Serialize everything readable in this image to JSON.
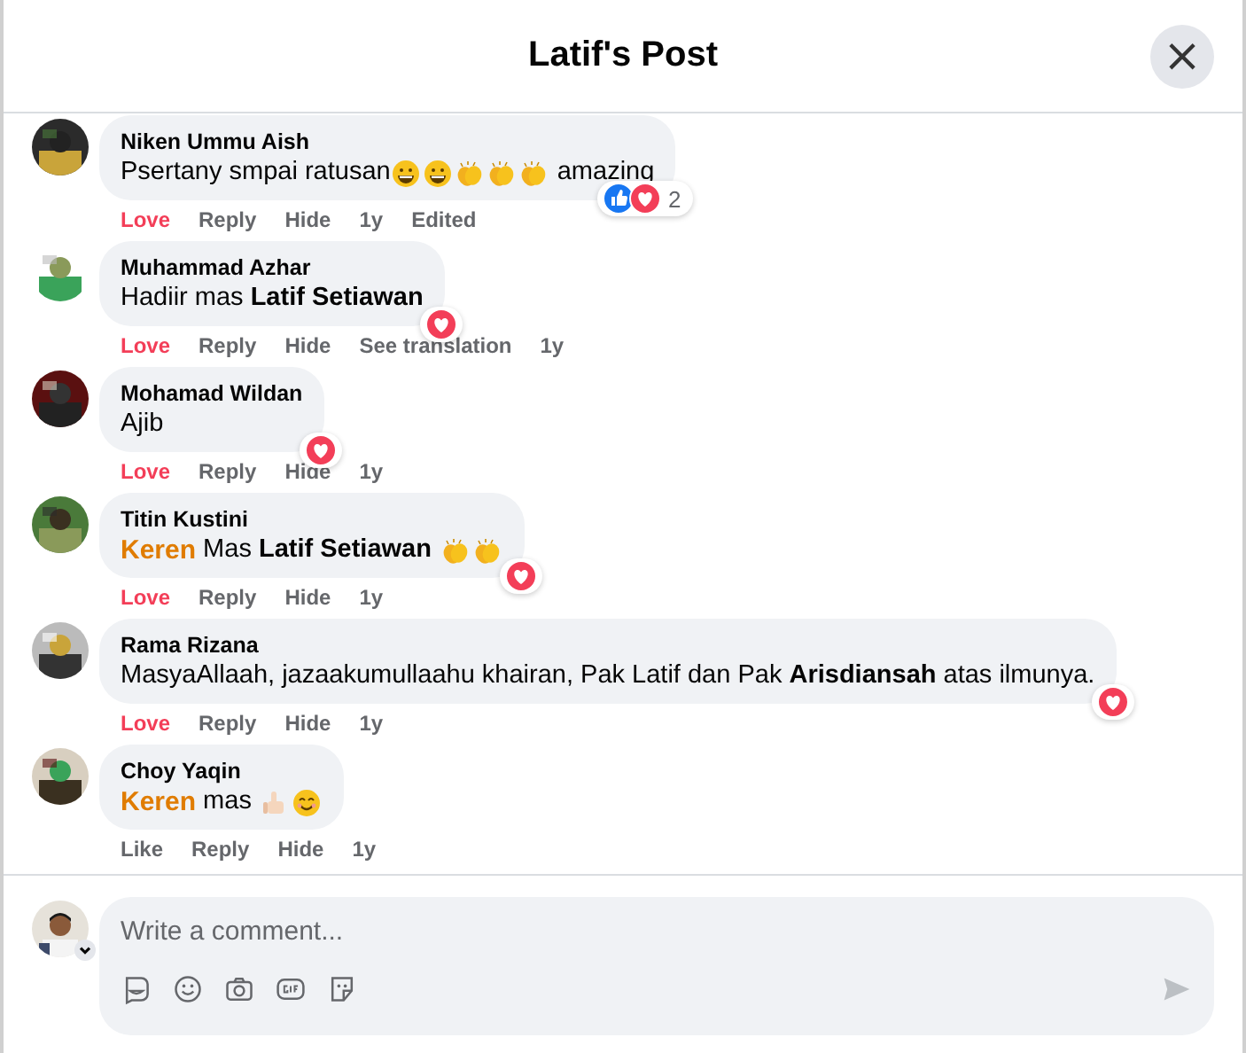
{
  "dialog": {
    "title": "Latif's Post",
    "close": "×"
  },
  "comments": [
    {
      "name": "Niken Ummu Aish",
      "segments": [
        {
          "kind": "text",
          "text": "Psertany smpai ratusan"
        },
        {
          "kind": "grin"
        },
        {
          "kind": "grin"
        },
        {
          "kind": "clap"
        },
        {
          "kind": "clap"
        },
        {
          "kind": "clap"
        },
        {
          "kind": "text",
          "text": " amazing"
        }
      ],
      "reactions": {
        "like": true,
        "love": true,
        "count": "2"
      },
      "reaction": {
        "label": "Love",
        "selected": true
      },
      "actions": [
        "Reply",
        "Hide",
        "1y",
        "Edited"
      ]
    },
    {
      "name": "Muhammad Azhar",
      "segments": [
        {
          "kind": "text",
          "text": "Hadiir mas "
        },
        {
          "kind": "bold",
          "text": "Latif Setiawan"
        }
      ],
      "reactions": {
        "love": true
      },
      "reaction": {
        "label": "Love",
        "selected": true
      },
      "actions": [
        "Reply",
        "Hide",
        "See translation",
        "1y"
      ]
    },
    {
      "name": "Mohamad Wildan",
      "segments": [
        {
          "kind": "text",
          "text": "Ajib"
        }
      ],
      "reactions": {
        "love": true
      },
      "reaction": {
        "label": "Love",
        "selected": true
      },
      "actions": [
        "Reply",
        "Hide",
        "1y"
      ]
    },
    {
      "name": "Titin Kustini",
      "segments": [
        {
          "kind": "highlight",
          "text": "Keren"
        },
        {
          "kind": "text",
          "text": " Mas "
        },
        {
          "kind": "bold",
          "text": "Latif Setiawan "
        },
        {
          "kind": "clap"
        },
        {
          "kind": "clap"
        }
      ],
      "reactions": {
        "love": true
      },
      "reaction": {
        "label": "Love",
        "selected": true
      },
      "actions": [
        "Reply",
        "Hide",
        "1y"
      ]
    },
    {
      "name": "Rama Rizana",
      "segments": [
        {
          "kind": "text",
          "text": "MasyaAllaah, jazaakumullaahu khairan, Pak Latif dan Pak "
        },
        {
          "kind": "bold",
          "text": "Arisdiansah"
        },
        {
          "kind": "text",
          "text": " atas ilmunya."
        }
      ],
      "reactions": {
        "love": true
      },
      "reaction": {
        "label": "Love",
        "selected": true
      },
      "actions": [
        "Reply",
        "Hide",
        "1y"
      ]
    },
    {
      "name": "Choy Yaqin",
      "segments": [
        {
          "kind": "highlight",
          "text": "Keren"
        },
        {
          "kind": "text",
          "text": " mas "
        },
        {
          "kind": "thumb"
        },
        {
          "kind": "smile"
        }
      ],
      "reaction": {
        "label": "Like",
        "selected": false
      },
      "actions": [
        "Reply",
        "Hide",
        "1y"
      ]
    }
  ],
  "composer": {
    "placeholder": "Write a comment..."
  }
}
